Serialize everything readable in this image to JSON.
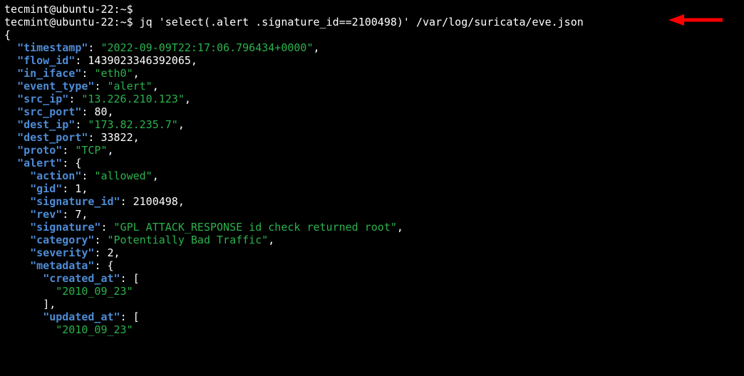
{
  "prompt1": {
    "user": "tecmint",
    "host": "ubuntu-22",
    "path": "~",
    "symbol": "$",
    "command": ""
  },
  "prompt2": {
    "user": "tecmint",
    "host": "ubuntu-22",
    "path": "~",
    "symbol": "$",
    "command": "jq 'select(.alert .signature_id==2100498)' /var/log/suricata/eve.json"
  },
  "output": {
    "open_brace": "{",
    "close_bracket": "],",
    "open_bracket": "[",
    "nested_open": "{",
    "timestamp_k": "\"timestamp\"",
    "timestamp_v": "\"2022-09-09T22:17:06.796434+0000\"",
    "flow_id_k": "\"flow_id\"",
    "flow_id_v": "1439023346392065",
    "in_iface_k": "\"in_iface\"",
    "in_iface_v": "\"eth0\"",
    "event_type_k": "\"event_type\"",
    "event_type_v": "\"alert\"",
    "src_ip_k": "\"src_ip\"",
    "src_ip_v": "\"13.226.210.123\"",
    "src_port_k": "\"src_port\"",
    "src_port_v": "80",
    "dest_ip_k": "\"dest_ip\"",
    "dest_ip_v": "\"173.82.235.7\"",
    "dest_port_k": "\"dest_port\"",
    "dest_port_v": "33822",
    "proto_k": "\"proto\"",
    "proto_v": "\"TCP\"",
    "alert_k": "\"alert\"",
    "action_k": "\"action\"",
    "action_v": "\"allowed\"",
    "gid_k": "\"gid\"",
    "gid_v": "1",
    "signature_id_k": "\"signature_id\"",
    "signature_id_v": "2100498",
    "rev_k": "\"rev\"",
    "rev_v": "7",
    "signature_k": "\"signature\"",
    "signature_v": "\"GPL ATTACK_RESPONSE id check returned root\"",
    "category_k": "\"category\"",
    "category_v": "\"Potentially Bad Traffic\"",
    "severity_k": "\"severity\"",
    "severity_v": "2",
    "metadata_k": "\"metadata\"",
    "created_at_k": "\"created_at\"",
    "created_at_v": "\"2010_09_23\"",
    "updated_at_k": "\"updated_at\"",
    "updated_at_v": "\"2010_09_23\""
  },
  "punct": {
    "comma": ",",
    "colon": ": "
  }
}
